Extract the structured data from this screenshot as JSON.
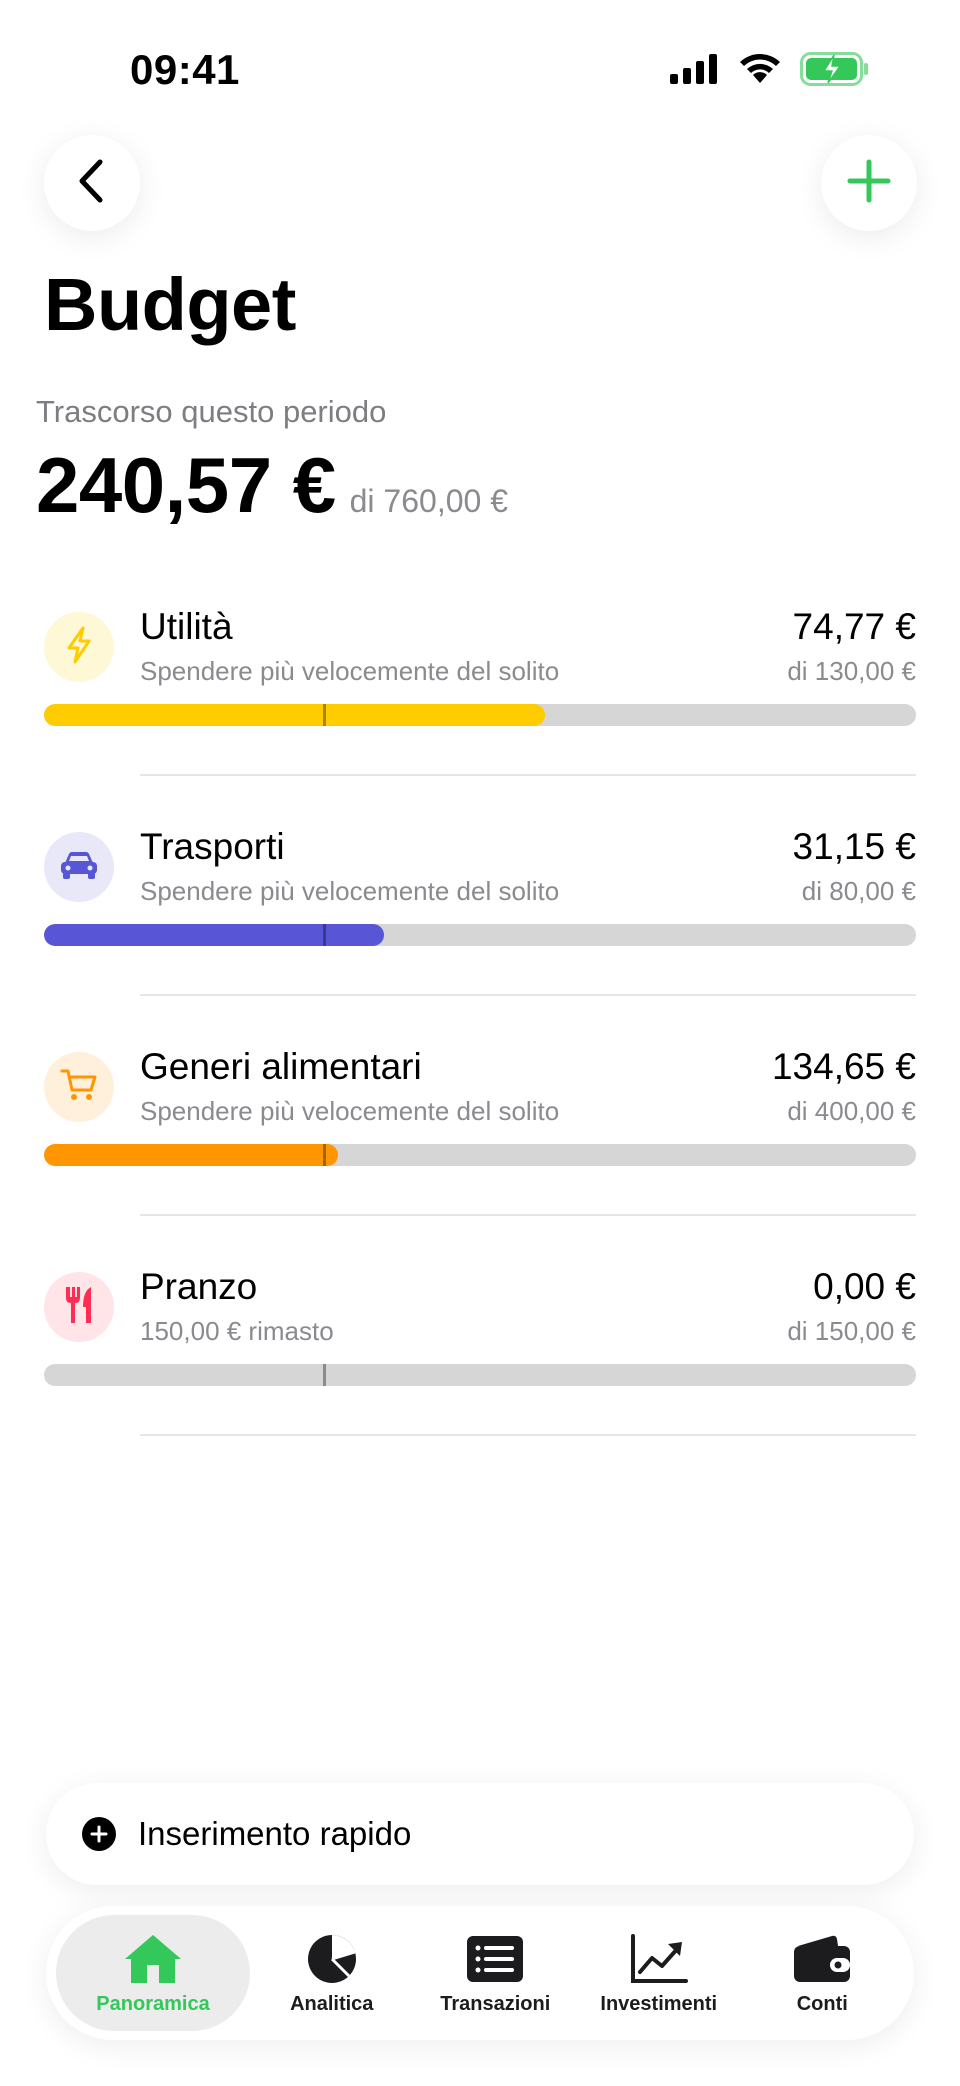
{
  "status_bar": {
    "time": "09:41"
  },
  "header": {
    "title": "Budget"
  },
  "summary": {
    "period_label": "Trascorso questo periodo",
    "spent": "240,57 €",
    "of_total": "di 760,00 €"
  },
  "budgets": [
    {
      "name": "Utilità",
      "subtitle": "Spendere più velocemente del solito",
      "amount": "74,77 €",
      "limit": "di 130,00 €",
      "progress": 0.575,
      "marker": 0.32,
      "color": "#ffcc00",
      "icon_bg": "#fff8d6",
      "icon": "bolt-icon"
    },
    {
      "name": "Trasporti",
      "subtitle": "Spendere più velocemente del solito",
      "amount": "31,15 €",
      "limit": "di 80,00 €",
      "progress": 0.39,
      "marker": 0.32,
      "color": "#5856d6",
      "icon_bg": "#e8e8f8",
      "icon": "car-icon"
    },
    {
      "name": "Generi alimentari",
      "subtitle": "Spendere più velocemente del solito",
      "amount": "134,65 €",
      "limit": "di 400,00 €",
      "progress": 0.337,
      "marker": 0.32,
      "color": "#ff9500",
      "icon_bg": "#fff0dc",
      "icon": "cart-icon"
    },
    {
      "name": "Pranzo",
      "subtitle": "150,00 € rimasto",
      "amount": "0,00 €",
      "limit": "di 150,00 €",
      "progress": 0,
      "marker": 0.32,
      "color": "#ff2d55",
      "icon_bg": "#ffe4e8",
      "icon": "fork-knife-icon"
    }
  ],
  "quick_entry": {
    "label": "Inserimento rapido"
  },
  "tabs": [
    {
      "label": "Panoramica",
      "icon": "home-icon",
      "active": true
    },
    {
      "label": "Analitica",
      "icon": "pie-chart-icon",
      "active": false
    },
    {
      "label": "Transazioni",
      "icon": "list-icon",
      "active": false
    },
    {
      "label": "Investimenti",
      "icon": "trend-chart-icon",
      "active": false
    },
    {
      "label": "Conti",
      "icon": "wallet-icon",
      "active": false
    }
  ],
  "colors": {
    "accent_green": "#34c759",
    "text_secondary": "#8a8a8f",
    "track": "#d6d6d6"
  }
}
